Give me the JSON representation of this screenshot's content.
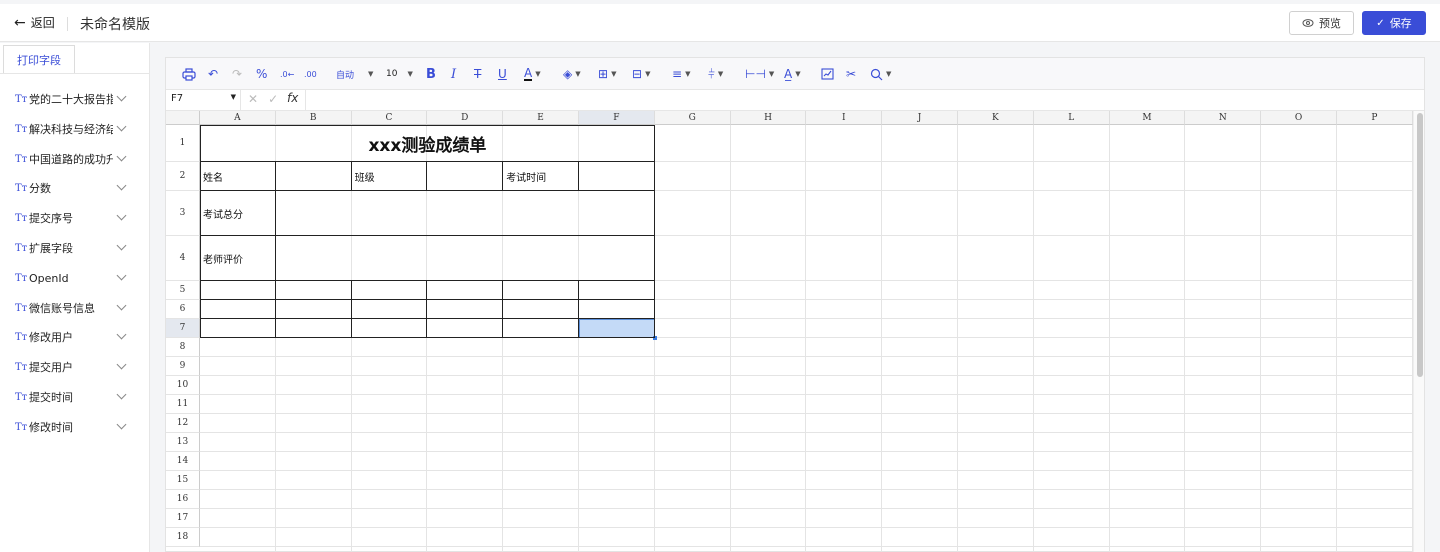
{
  "header": {
    "back_label": "返回",
    "title": "未命名模版",
    "preview_label": "预览",
    "save_label": "保存"
  },
  "sidebar": {
    "tab_label": "打印字段",
    "items": [
      {
        "label": "党的二十大报告指"
      },
      {
        "label": "解决科技与经济结"
      },
      {
        "label": "中国道路的成功升"
      },
      {
        "label": "分数"
      },
      {
        "label": "提交序号"
      },
      {
        "label": "扩展字段"
      },
      {
        "label": "OpenId"
      },
      {
        "label": "微信账号信息"
      },
      {
        "label": "修改用户"
      },
      {
        "label": "提交用户"
      },
      {
        "label": "提交时间"
      },
      {
        "label": "修改时间"
      }
    ]
  },
  "toolbar": {
    "font_name": "自动",
    "font_size": "10",
    "icons": [
      "print-icon",
      "undo-icon",
      "redo-icon",
      "percent-icon",
      "decrease-decimal-icon",
      "increase-decimal-icon",
      "bold-icon",
      "italic-icon",
      "strikethrough-icon",
      "underline-icon",
      "font-color-icon",
      "fill-color-icon",
      "borders-icon",
      "merge-icon",
      "align-left-icon",
      "vertical-align-icon",
      "column-width-icon",
      "text-rotate-icon",
      "chart-icon",
      "cut-icon",
      "zoom-icon"
    ]
  },
  "formula_bar": {
    "cell_ref": "F7",
    "fx_label": "fx"
  },
  "sheet": {
    "columns": [
      "A",
      "B",
      "C",
      "D",
      "E",
      "F",
      "G",
      "H",
      "I",
      "J",
      "K",
      "L",
      "M",
      "N",
      "O",
      "P"
    ],
    "rows": [
      "1",
      "2",
      "3",
      "4",
      "5",
      "6",
      "7",
      "8",
      "9",
      "10",
      "11",
      "12",
      "13",
      "14",
      "15",
      "16",
      "17",
      "18"
    ],
    "selected_column": "F",
    "selected_row": "7",
    "cells": {
      "title": "xxx测验成绩单",
      "name_label": "姓名",
      "class_label": "班级",
      "exam_time_label": "考试时间",
      "total_score_label": "考试总分",
      "teacher_comment_label": "老师评价"
    }
  },
  "colors": {
    "accent": "#3a4dd7",
    "selection": "#c4daf7"
  }
}
